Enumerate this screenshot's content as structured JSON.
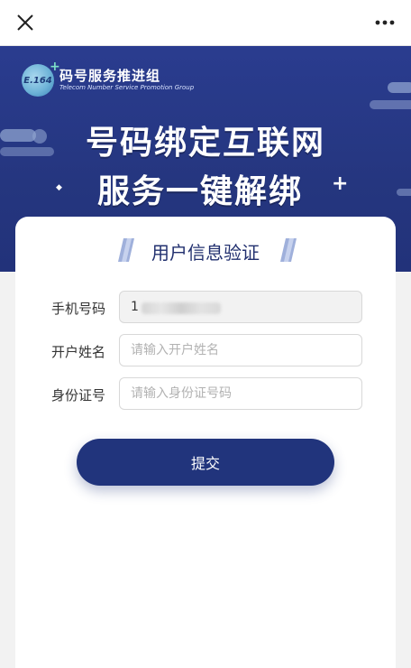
{
  "logo": {
    "badge": "E.164",
    "name_cn": "码号服务推进组",
    "name_en": "Telecom Number Service Promotion Group"
  },
  "banner": {
    "line1": "号码绑定互联网",
    "line2": "服务一键解绑"
  },
  "form": {
    "title": "用户信息验证",
    "phone": {
      "label": "手机号码",
      "value": "1"
    },
    "name": {
      "label": "开户姓名",
      "placeholder": "请输入开户姓名"
    },
    "id": {
      "label": "身份证号",
      "placeholder": "请输入身份证号码"
    },
    "submit": "提交"
  },
  "colors": {
    "banner": "#25367f",
    "button": "#21347c",
    "title": "#22306f"
  },
  "icons": {
    "close": "close-icon",
    "more": "more-icon"
  }
}
